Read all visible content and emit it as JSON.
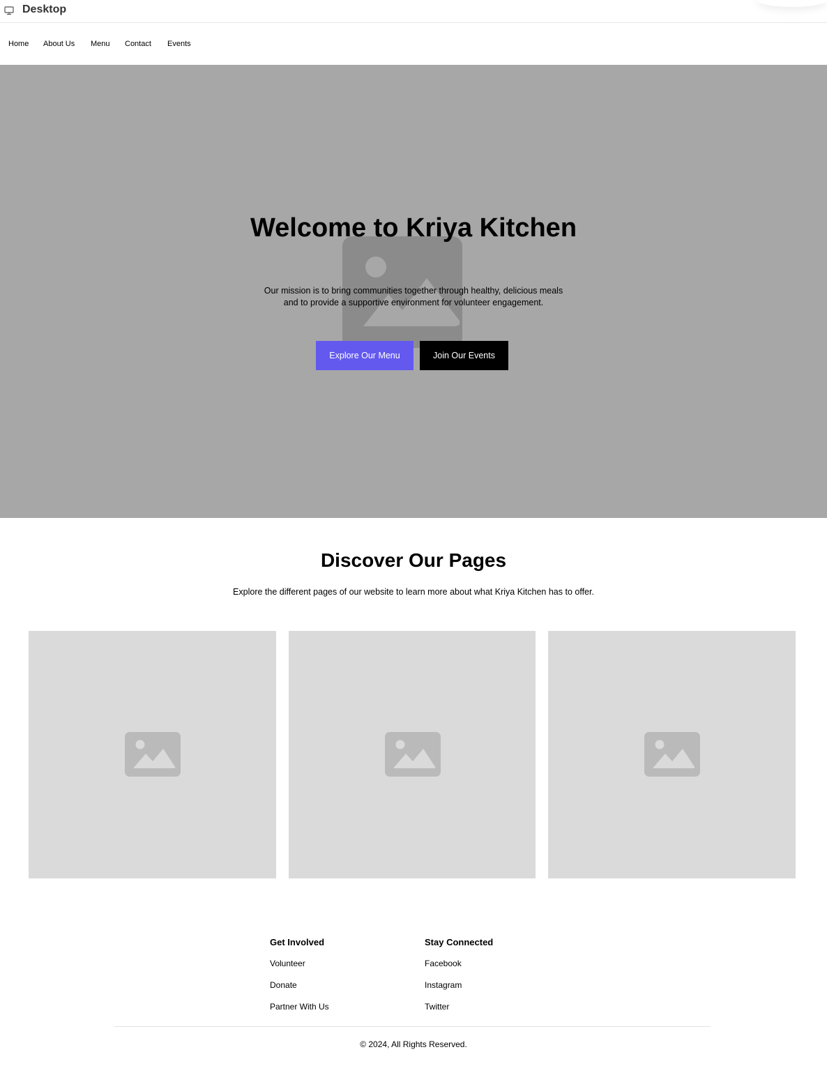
{
  "window": {
    "title": "Desktop",
    "icon": "monitor-icon"
  },
  "nav": {
    "items": [
      {
        "label": "Home"
      },
      {
        "label": "About Us"
      },
      {
        "label": "Menu"
      },
      {
        "label": "Contact"
      },
      {
        "label": "Events"
      }
    ]
  },
  "hero": {
    "title": "Welcome to Kriya Kitchen",
    "description": "Our mission is to bring communities together through healthy, delicious meals and to provide a supportive environment for volunteer engagement.",
    "primary_button": "Explore Our Menu",
    "secondary_button": "Join Our Events",
    "background_color": "#a7a7a7",
    "image_icon": "image-placeholder-icon"
  },
  "discover": {
    "title": "Discover Our Pages",
    "subtitle": "Explore the different pages of our website to learn more about what Kriya Kitchen has to offer.",
    "cards": [
      {
        "icon": "image-placeholder-icon"
      },
      {
        "icon": "image-placeholder-icon"
      },
      {
        "icon": "image-placeholder-icon"
      }
    ]
  },
  "footer": {
    "columns": [
      {
        "heading": "Get Involved",
        "links": [
          "Volunteer",
          "Donate",
          "Partner With Us"
        ]
      },
      {
        "heading": "Stay Connected",
        "links": [
          "Facebook",
          "Instagram",
          "Twitter"
        ]
      }
    ],
    "copyright": "© 2024, All Rights Reserved."
  },
  "colors": {
    "accent": "#6359ee",
    "dark_button": "#000000",
    "card_placeholder": "#dadada"
  }
}
